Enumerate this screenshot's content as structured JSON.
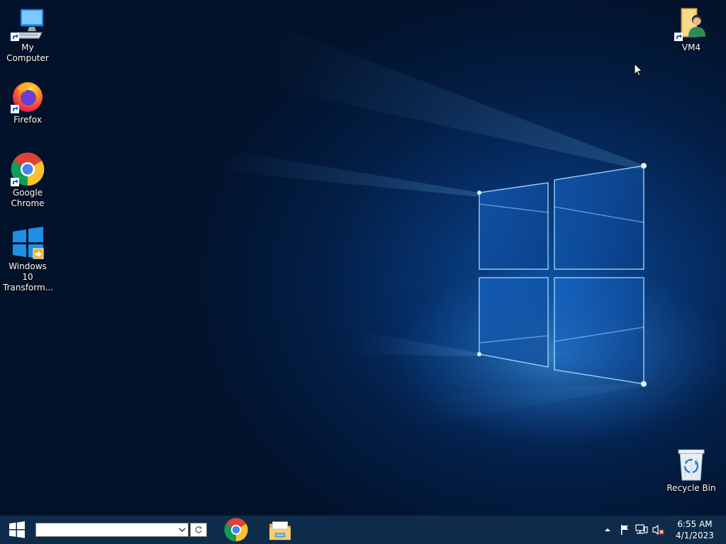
{
  "desktop": {
    "icons": [
      {
        "label": "My Computer",
        "icon": "computer-icon"
      },
      {
        "label": "Firefox",
        "icon": "firefox-icon"
      },
      {
        "label": "Google Chrome",
        "icon": "chrome-icon"
      },
      {
        "label": "Windows 10 Transform...",
        "icon": "windows-transform-icon"
      },
      {
        "label": "VM4",
        "icon": "user-folder-icon"
      },
      {
        "label": "Recycle Bin",
        "icon": "recycle-bin-icon"
      }
    ]
  },
  "taskbar": {
    "start_icon": "windows-logo-icon",
    "search": {
      "value": "",
      "placeholder": ""
    },
    "pinned_apps": [
      {
        "name": "Google Chrome",
        "icon": "chrome-icon"
      },
      {
        "name": "File Explorer",
        "icon": "file-explorer-icon"
      }
    ],
    "tray": {
      "icons": [
        "show-hidden-icons-icon",
        "action-center-flag-icon",
        "network-icon",
        "volume-muted-icon"
      ],
      "time": "6:55 AM",
      "date": "4/1/2023"
    }
  },
  "colors": {
    "taskbar": "#0f2b4a",
    "desktop_glow": "#0b4d9a",
    "desktop_dark": "#02122b"
  }
}
